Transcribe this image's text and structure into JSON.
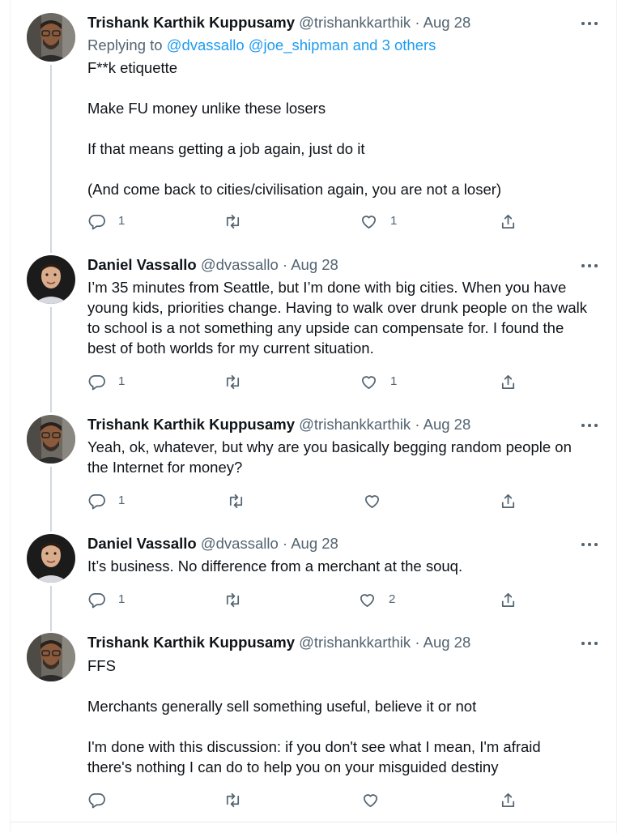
{
  "colors": {
    "text": "#0f1419",
    "secondary": "#536471",
    "link": "#1d9bf0",
    "thread_line": "#cfd9de"
  },
  "tweets": [
    {
      "name": "Trishank Karthik Kuppusamy",
      "handle": "@trishankkarthik",
      "separator": "·",
      "date": "Aug 28",
      "avatar": "avatar-trishank",
      "replying_to": {
        "prefix": "Replying to",
        "links": "@dvassallo @joe_shipman and 3 others"
      },
      "paragraphs": [
        "F**k etiquette",
        "Make FU money unlike these losers",
        "If that means getting a job again, just do it",
        "(And come back to cities/civilisation again, you are not a loser)"
      ],
      "replies": "1",
      "retweets": "",
      "likes": "1"
    },
    {
      "name": "Daniel Vassallo",
      "handle": "@dvassallo",
      "separator": "·",
      "date": "Aug 28",
      "avatar": "avatar-daniel",
      "lines": [
        "I’m 35 minutes from Seattle, but I’m done with big cities. When you have",
        "young kids, priorities change. Having to walk over drunk people on the walk",
        "to school is a not something any upside can compensate for. I found the",
        "best of both worlds for my current situation."
      ],
      "replies": "1",
      "retweets": "",
      "likes": "1"
    },
    {
      "name": "Trishank Karthik Kuppusamy",
      "handle": "@trishankkarthik",
      "separator": "·",
      "date": "Aug 28",
      "avatar": "avatar-trishank",
      "lines": [
        "Yeah, ok, whatever, but why are you basically begging random people on",
        "the Internet for money?"
      ],
      "replies": "1",
      "retweets": "",
      "likes": ""
    },
    {
      "name": "Daniel Vassallo",
      "handle": "@dvassallo",
      "separator": "·",
      "date": "Aug 28",
      "avatar": "avatar-daniel",
      "lines": [
        "It’s business. No difference from a merchant at the souq."
      ],
      "replies": "1",
      "retweets": "",
      "likes": "2"
    },
    {
      "name": "Trishank Karthik Kuppusamy",
      "handle": "@trishankkarthik",
      "separator": "·",
      "date": "Aug 28",
      "avatar": "avatar-trishank",
      "blocks": [
        [
          "FFS"
        ],
        [
          "Merchants generally sell something useful, believe it or not"
        ],
        [
          "I'm done with this discussion: if you don't see what I mean, I'm afraid",
          "there's nothing I can do to help you on your misguided destiny"
        ]
      ],
      "replies": "",
      "retweets": "",
      "likes": ""
    }
  ],
  "icons": {
    "reply": "reply-icon",
    "retweet": "retweet-icon",
    "like": "heart-icon",
    "share": "share-icon",
    "more": "more-icon"
  }
}
